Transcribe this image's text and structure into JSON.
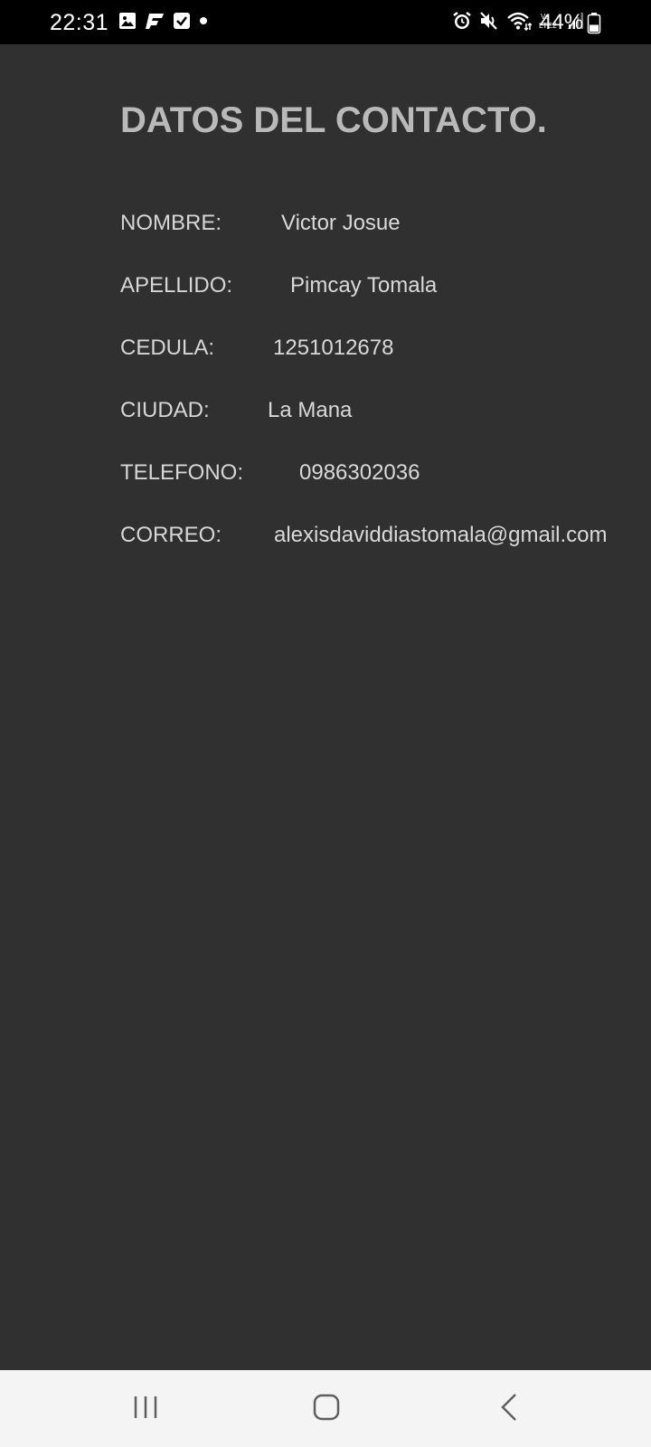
{
  "status_bar": {
    "time": "22:31",
    "left_icons": [
      "gallery-icon",
      "flipboard-icon",
      "checkbox-icon",
      "dot-icon"
    ],
    "right_icons": [
      "alarm-icon",
      "mute-icon",
      "wifi-icon",
      "volte-icon",
      "signal-icon"
    ],
    "volte_label": "Vo\nLTE2",
    "battery_percent": "44%",
    "battery_level": 0.44
  },
  "page": {
    "title": "DATOS DEL CONTACTO."
  },
  "contact": {
    "fields": [
      {
        "label": "NOMBRE:",
        "value": "Victor Josue"
      },
      {
        "label": "APELLIDO:",
        "value": "Pimcay Tomala"
      },
      {
        "label": "CEDULA:",
        "value": "1251012678"
      },
      {
        "label": "CIUDAD:",
        "value": "La Mana"
      },
      {
        "label": "TELEFONO:",
        "value": "0986302036"
      },
      {
        "label": "CORREO:",
        "value": "alexisdaviddiastomala@gmail.com"
      }
    ]
  },
  "nav_bar": {
    "buttons": [
      "recent-apps-icon",
      "home-icon",
      "back-icon"
    ]
  },
  "colors": {
    "background": "#303030",
    "status_bar": "#000000",
    "title": "#b9b9b9",
    "text": "#d6d6d6",
    "nav_bar": "#f4f4f4",
    "nav_icon": "#5f5f5f"
  }
}
